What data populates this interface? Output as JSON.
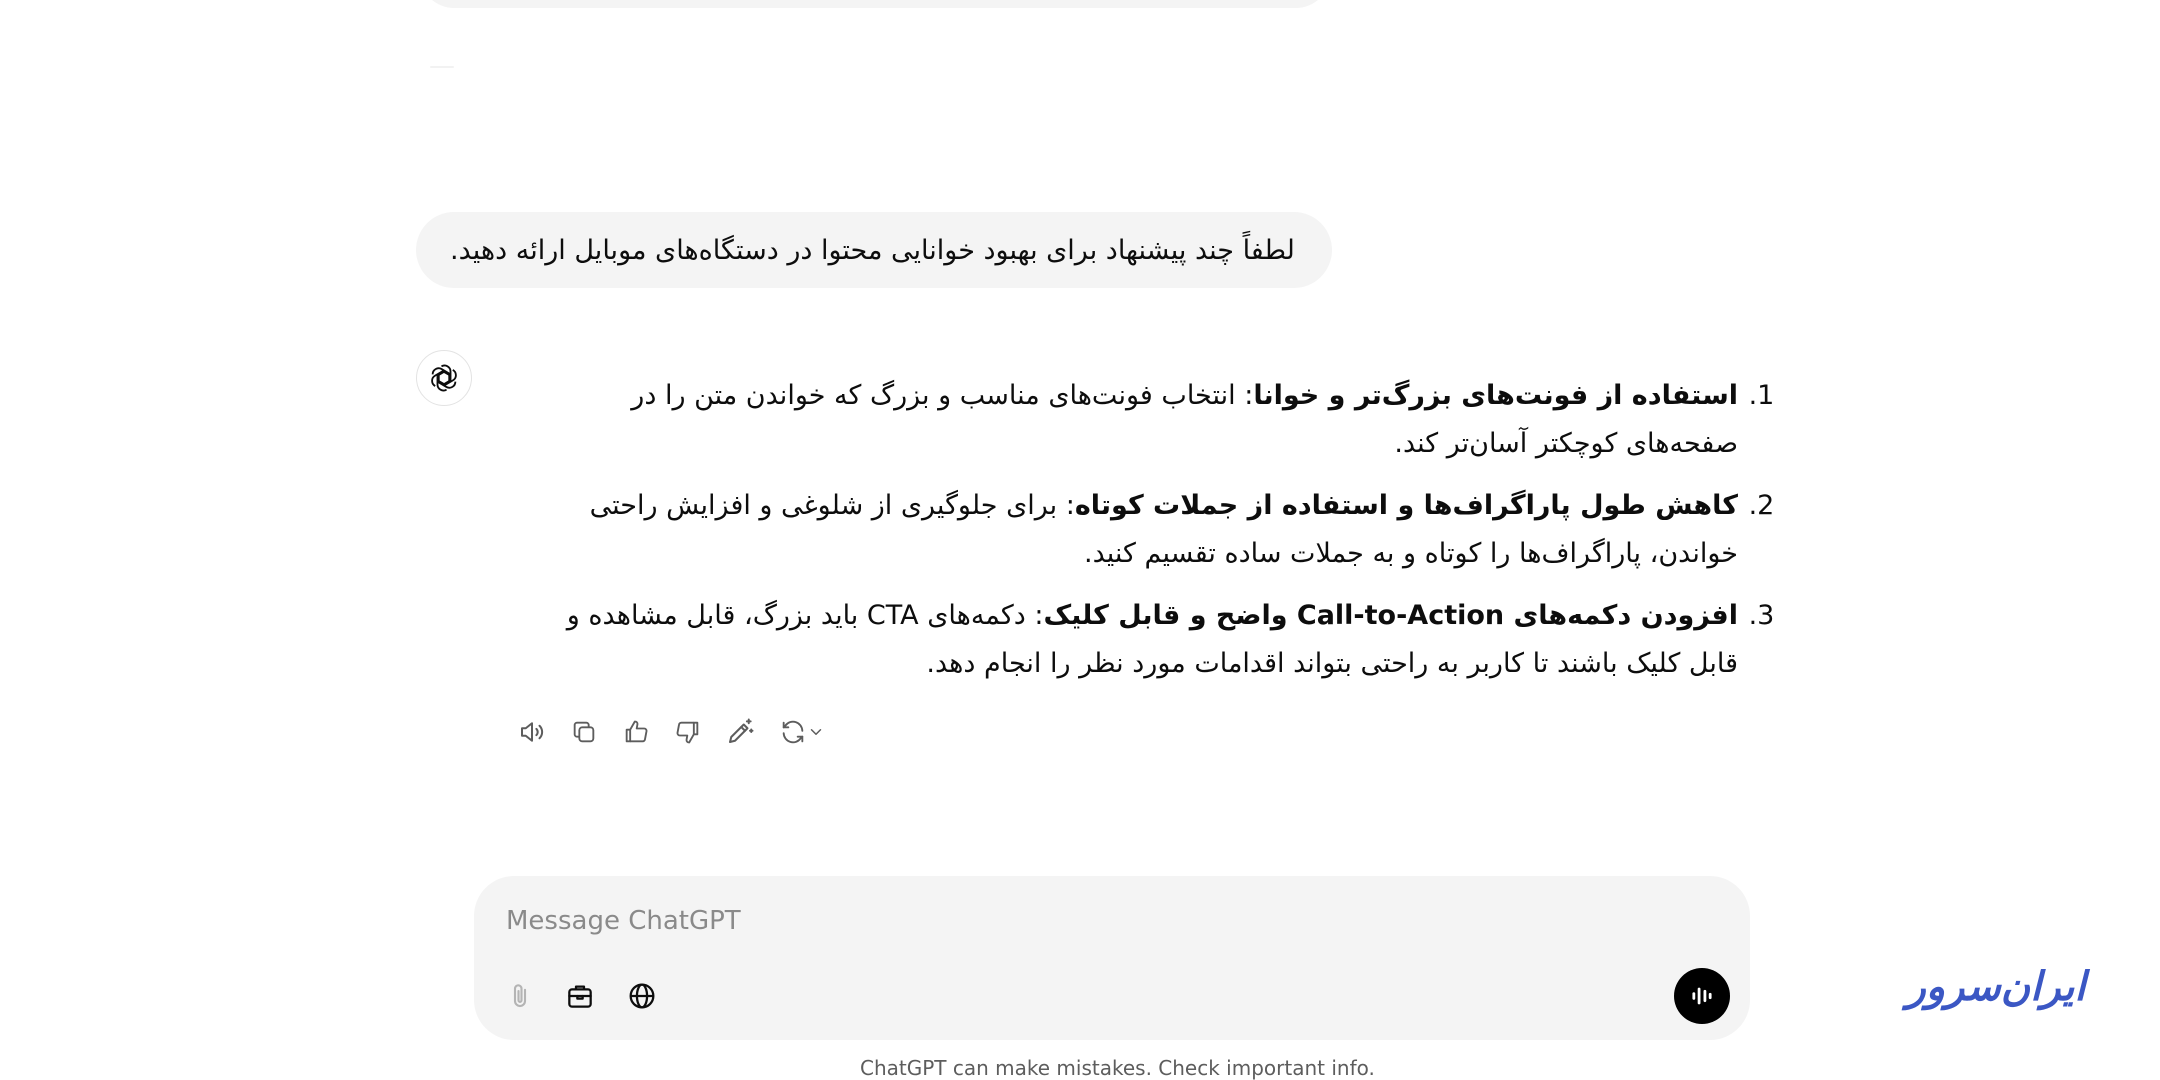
{
  "conversation": {
    "user_message": "لطفاً چند پیشنهاد برای بهبود خوانایی محتوا در دستگاه‌های موبایل ارائه دهید.",
    "answer": {
      "items": [
        {
          "bold": "استفاده از فونت‌های بزرگ‌تر و خوانا",
          "text": ": انتخاب فونت‌های مناسب و بزرگ که خواندن متن را در صفحه‌های کوچکتر آسان‌تر کند."
        },
        {
          "bold": "کاهش طول پاراگراف‌ها و استفاده از جملات کوتاه",
          "text": ": برای جلوگیری از شلوغی و افزایش راحتی خواندن، پاراگراف‌ها را کوتاه و به جملات ساده تقسیم کنید."
        },
        {
          "bold": "افزودن دکمه‌های Call-to-Action واضح و قابل کلیک",
          "text": ": دکمه‌های CTA باید بزرگ، قابل مشاهده و قابل کلیک باشند تا کاربر به راحتی بتواند اقدامات مورد نظر را انجام دهد."
        }
      ]
    },
    "actions": [
      {
        "name": "read-aloud-button",
        "icon": "speaker-icon"
      },
      {
        "name": "copy-button",
        "icon": "copy-icon"
      },
      {
        "name": "thumbs-up-button",
        "icon": "thumbs-up-icon"
      },
      {
        "name": "thumbs-down-button",
        "icon": "thumbs-down-icon"
      },
      {
        "name": "edit-canvas-button",
        "icon": "pencil-sparkle-icon"
      },
      {
        "name": "regenerate-button",
        "icon": "refresh-icon"
      }
    ]
  },
  "composer": {
    "placeholder": "Message ChatGPT",
    "value": "",
    "tools": [
      "paperclip-icon",
      "toolbox-icon",
      "globe-icon"
    ],
    "voice_icon": "voice-waveform-icon"
  },
  "footer": {
    "disclaimer": "ChatGPT can make mistakes. Check important info."
  },
  "watermark": {
    "logo_text": "ایران سرور",
    "color": "#3b57c4"
  },
  "colors": {
    "bubble": "#f4f4f4",
    "text": "#0d0d0d",
    "muted": "#5d5d5d"
  }
}
